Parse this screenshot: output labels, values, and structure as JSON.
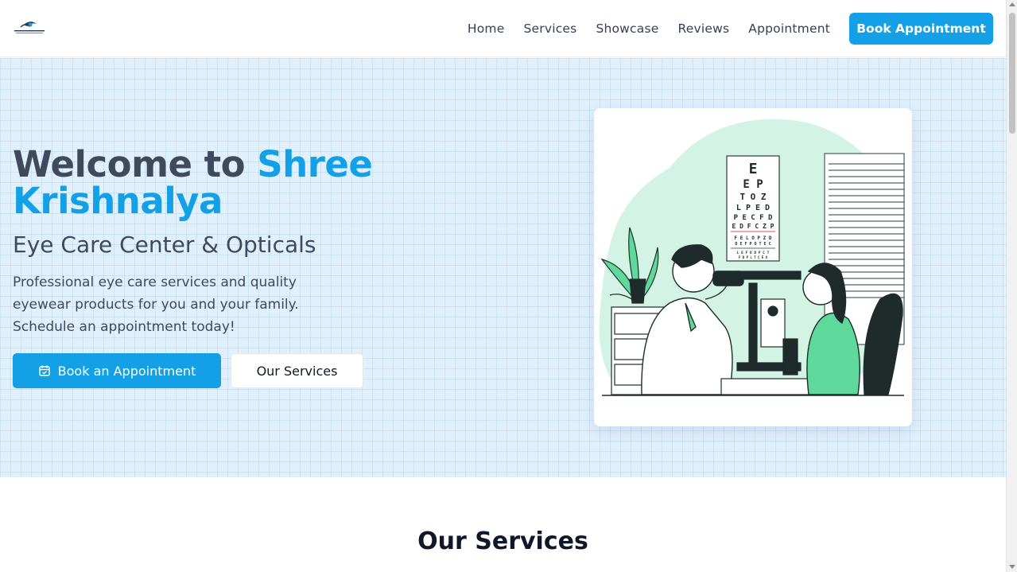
{
  "header": {
    "nav": [
      {
        "label": "Home"
      },
      {
        "label": "Services"
      },
      {
        "label": "Showcase"
      },
      {
        "label": "Reviews"
      },
      {
        "label": "Appointment"
      }
    ],
    "cta_label": "Book Appointment"
  },
  "hero": {
    "title_prefix": "Welcome to ",
    "title_accent": "Shree Krishnalya",
    "subtitle": "Eye Care Center & Opticals",
    "description": "Professional eye care services and quality eyewear products for you and your family. Schedule an appointment today!",
    "primary_button": "Book an Appointment",
    "primary_icon": "calendar-icon",
    "secondary_button": "Our Services",
    "illustration": "eye-exam-illustration"
  },
  "services": {
    "heading": "Our Services"
  },
  "colors": {
    "accent": "#14a0e6",
    "heading": "#3f4a5c",
    "hero_bg": "#e1f0fd",
    "illustration_green": "#5ed89b"
  }
}
